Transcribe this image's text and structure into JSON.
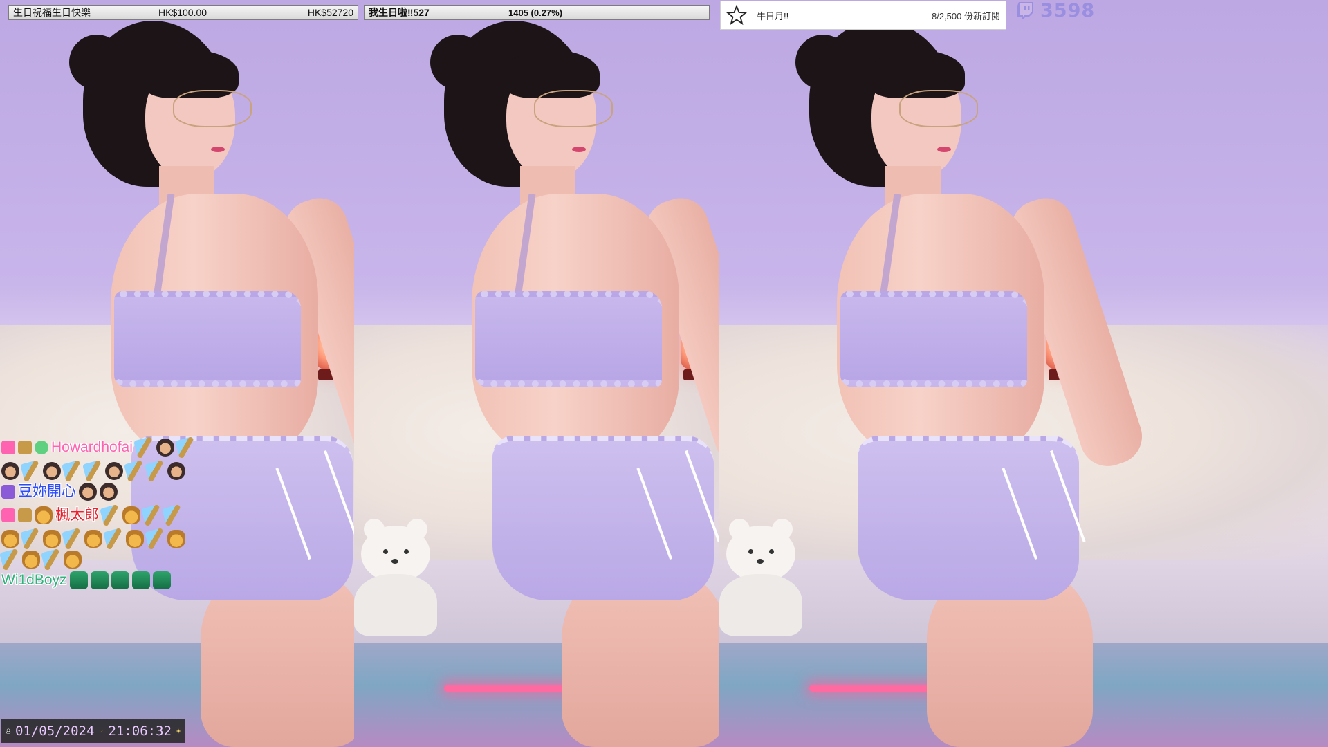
{
  "donation_bar": {
    "left_message": "生日祝福生日快樂",
    "left_amount": "HK$100.00",
    "left_total": "HK$52720",
    "right_title": "我生日啦‼527",
    "right_progress": "1405 (0.27%)"
  },
  "sub_goal": {
    "title": "牛日月!!",
    "count": "8/2,500 份新訂閱"
  },
  "viewer_count": "3598",
  "chat": {
    "messages": [
      {
        "user": "Howardhofai",
        "color": "#ff62b0"
      },
      {
        "user": "豆妳開心",
        "color": "#2a4bff"
      },
      {
        "user": "楓太郎",
        "color": "#e8222e"
      },
      {
        "user": "Wi1dBoyz",
        "color": "#2fb27c"
      }
    ]
  },
  "datetime": {
    "date": "01/05/2024",
    "time": "21:06:32"
  },
  "icons": {
    "star": "star-outline-icon",
    "twitch": "twitch-logo-icon",
    "user": "user-icon",
    "banana": "banana-icon",
    "sparkle": "sparkle-icon"
  }
}
